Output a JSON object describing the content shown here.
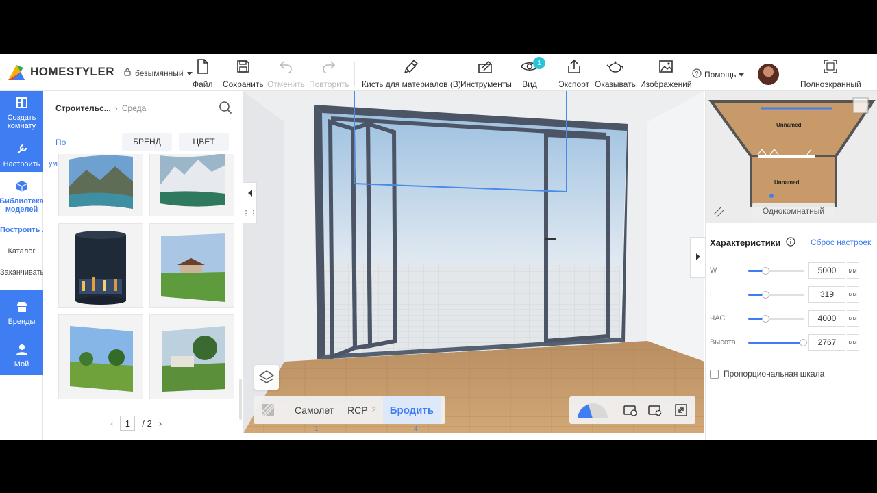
{
  "app": {
    "brand": "HOMESTYLER",
    "doc_name": "безымянный"
  },
  "toolbar": [
    {
      "key": "file",
      "label": "Файл",
      "icon": "file-icon"
    },
    {
      "key": "save",
      "label": "Сохранить",
      "icon": "save-icon"
    },
    {
      "key": "undo",
      "label": "Отменить",
      "icon": "undo-icon",
      "disabled": true
    },
    {
      "key": "redo",
      "label": "Повторить",
      "icon": "redo-icon",
      "disabled": true
    },
    {
      "key": "brush",
      "label": "Кисть для материалов (B)",
      "icon": "paint-brush-icon"
    },
    {
      "key": "tools",
      "label": "Инструменты",
      "icon": "tools-icon"
    },
    {
      "key": "view",
      "label": "Вид",
      "icon": "eye-icon",
      "badge": "1"
    },
    {
      "key": "export",
      "label": "Экспорт",
      "icon": "export-icon"
    },
    {
      "key": "render",
      "label": "Оказывать",
      "icon": "teapot-icon"
    },
    {
      "key": "images",
      "label": "Изображений",
      "icon": "image-icon"
    }
  ],
  "help": {
    "label": "Помощь"
  },
  "fullscreen": {
    "label": "Полноэкранный"
  },
  "leftnav": {
    "create_room": "Создать комнату",
    "customize": "Настроить",
    "model_library": "Библиотека моделей",
    "build": "Построить ..",
    "catalog": "Каталог",
    "finish": "Заканчивать",
    "brands": "Бренды",
    "my": "Мой"
  },
  "catalog": {
    "crumb_primary": "Строительс...",
    "crumb_secondary": "Среда",
    "sort_label": "По",
    "sort_label2": "умолчанию",
    "filter_brand": "БРЕНД",
    "filter_color": "ЦВЕТ",
    "page_current": "1",
    "page_total": "/ 2"
  },
  "viewport": {
    "modes": [
      {
        "label": "Самолет",
        "key": "1",
        "active": false
      },
      {
        "label": "RCP",
        "key": "2",
        "active": false
      },
      {
        "label": "Бродить",
        "key": "4",
        "active": true
      }
    ]
  },
  "minimap": {
    "room1": "Unnamed",
    "room2": "Unnamed",
    "room_type": "Однокомнатный"
  },
  "properties": {
    "title": "Характеристики",
    "reset": "Сброс настроек",
    "rows": [
      {
        "label": "W",
        "value": "5000",
        "unit": "мм",
        "level": 0.3
      },
      {
        "label": "L",
        "value": "319",
        "unit": "мм",
        "level": 0.3
      },
      {
        "label": "ЧАС",
        "value": "4000",
        "unit": "мм",
        "level": 0.3
      },
      {
        "label": "Высота",
        "value": "2767",
        "unit": "мм",
        "level": 0.97
      }
    ],
    "proportional": "Пропорциональная шкала"
  },
  "colors": {
    "accent": "#3f7df2",
    "badge": "#28c5d8",
    "floor": "#c89a6a",
    "door_frame": "#4b5566"
  }
}
